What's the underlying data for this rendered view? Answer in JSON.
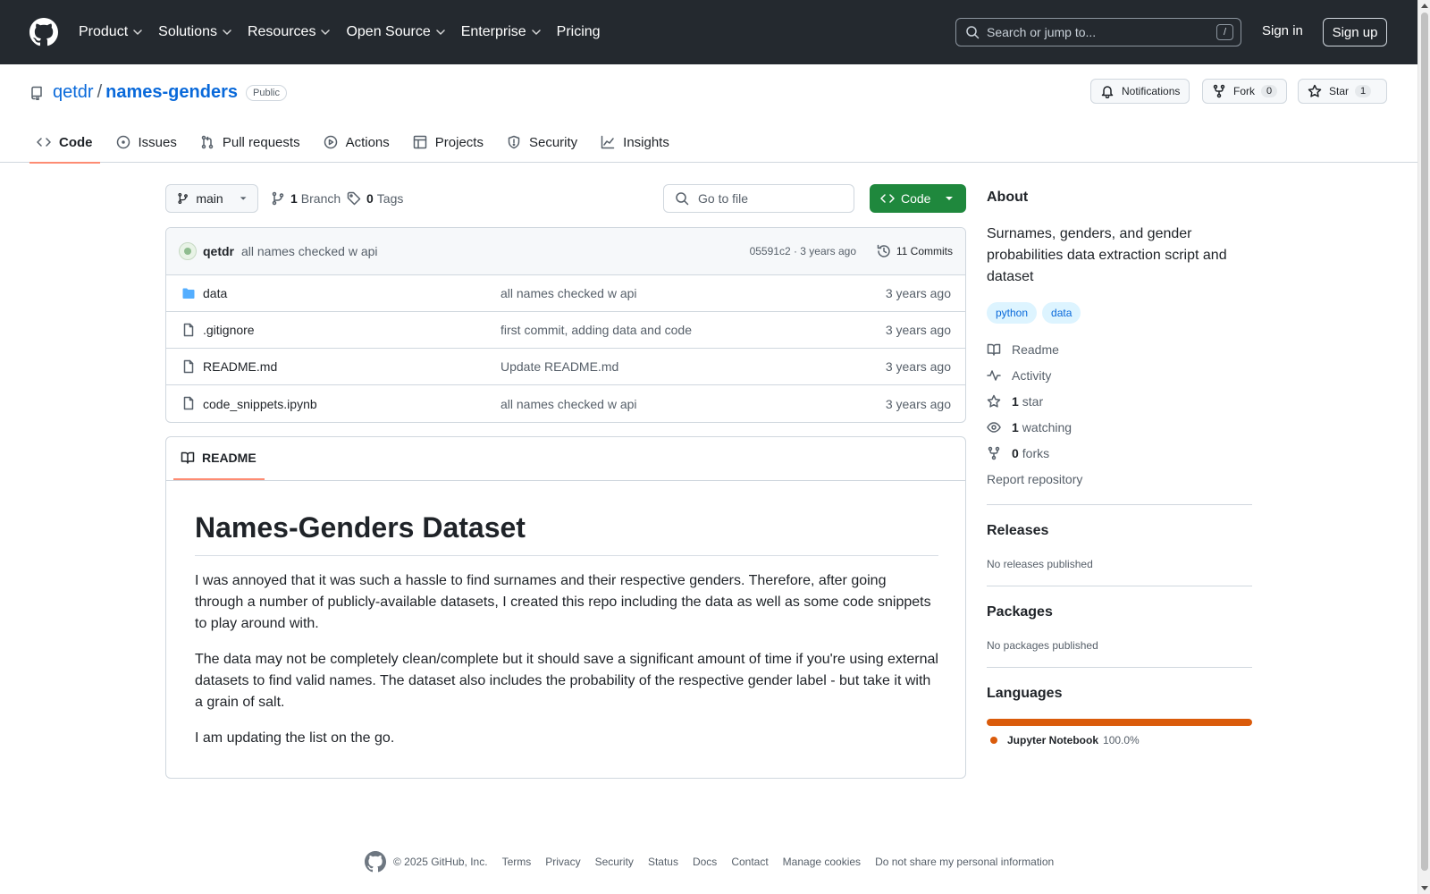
{
  "header": {
    "nav": [
      "Product",
      "Solutions",
      "Resources",
      "Open Source",
      "Enterprise",
      "Pricing"
    ],
    "search_placeholder": "Search or jump to...",
    "search_shortcut": "/",
    "signin": "Sign in",
    "signup": "Sign up"
  },
  "repo": {
    "owner": "qetdr",
    "separator": "/",
    "name": "names-genders",
    "visibility": "Public",
    "notifications": "Notifications",
    "fork_label": "Fork",
    "fork_count": "0",
    "star_label": "Star",
    "star_count": "1"
  },
  "tabs": [
    "Code",
    "Issues",
    "Pull requests",
    "Actions",
    "Projects",
    "Security",
    "Insights"
  ],
  "branchbar": {
    "branch": "main",
    "branch_count": "1",
    "branch_label": "Branch",
    "tag_count": "0",
    "tag_label": "Tags",
    "goto_placeholder": "Go to file",
    "code_button": "Code"
  },
  "commit": {
    "author": "qetdr",
    "message": "all names checked w api",
    "hash_age": "05591c2 · 3 years ago",
    "commits": "11 Commits"
  },
  "files": [
    {
      "name": "data",
      "type": "folder",
      "message": "all names checked w api",
      "age": "3 years ago"
    },
    {
      "name": ".gitignore",
      "type": "file",
      "message": "first commit, adding data and code",
      "age": "3 years ago"
    },
    {
      "name": "README.md",
      "type": "file",
      "message": "Update README.md",
      "age": "3 years ago"
    },
    {
      "name": "code_snippets.ipynb",
      "type": "file",
      "message": "all names checked w api",
      "age": "3 years ago"
    }
  ],
  "readme": {
    "tab": "README",
    "title": "Names-Genders Dataset",
    "p1": "I was annoyed that it was such a hassle to find surnames and their respective genders. Therefore, after going through a number of publicly-available datasets, I created this repo including the data as well as some code snippets to play around with.",
    "p2": "The data may not be completely clean/complete but it should save a significant amount of time if you're using external datasets to find valid names. The dataset also includes the probability of the respective gender label - but take it with a grain of salt.",
    "p3": "I am updating the list on the go."
  },
  "about": {
    "heading": "About",
    "description": "Surnames, genders, and gender probabilities data extraction script and dataset",
    "topics": [
      "python",
      "data"
    ],
    "readme": "Readme",
    "activity": "Activity",
    "stars_count": "1",
    "stars_label": "star",
    "watching_count": "1",
    "watching_label": "watching",
    "forks_count": "0",
    "forks_label": "forks",
    "report": "Report repository"
  },
  "releases": {
    "heading": "Releases",
    "text": "No releases published"
  },
  "packages": {
    "heading": "Packages",
    "text": "No packages published"
  },
  "languages": {
    "heading": "Languages",
    "items": [
      {
        "name": "Jupyter Notebook",
        "percent": "100.0%",
        "color": "#DA5B0B"
      }
    ]
  },
  "footer": {
    "copyright": "© 2025 GitHub, Inc.",
    "links": [
      "Terms",
      "Privacy",
      "Security",
      "Status",
      "Docs",
      "Contact",
      "Manage cookies",
      "Do not share my personal information"
    ]
  },
  "colors": {
    "accent": "#0969da",
    "code_button": "#1f883d",
    "tab_underline": "#fd8c73",
    "header_bg": "#24292f"
  }
}
